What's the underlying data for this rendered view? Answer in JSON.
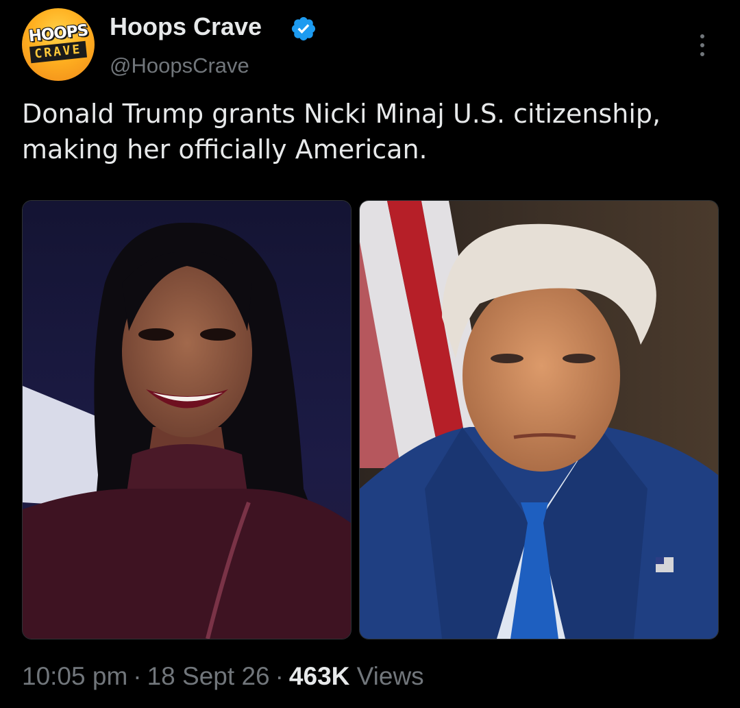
{
  "author": {
    "display_name": "Hoops Crave",
    "handle": "@HoopsCrave",
    "avatar_text_top": "HOOPS",
    "avatar_text_bottom": "CRAVE",
    "verified": true,
    "verified_color": "#1d9bf0"
  },
  "tweet": {
    "text": "Donald Trump grants Nicki Minaj U.S. citizenship, making her officially American."
  },
  "media": [
    {
      "subject": "Nicki Minaj portrait",
      "icon": "photo"
    },
    {
      "subject": "Donald Trump portrait",
      "icon": "photo"
    }
  ],
  "meta": {
    "time": "10:05 pm",
    "separator": "·",
    "date": "18 Sept 26",
    "views_count": "463K",
    "views_label": "Views"
  },
  "colors": {
    "background": "#000000",
    "primary_text": "#e7e9ea",
    "secondary_text": "#71767b",
    "accent": "#1d9bf0"
  },
  "icons": {
    "verified": "verified-badge-icon",
    "more": "more-options-icon"
  }
}
